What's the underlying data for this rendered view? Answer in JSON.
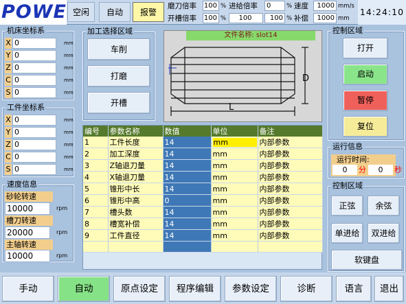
{
  "header": {
    "logo": "POWER",
    "modes": [
      {
        "label": "空闲",
        "active": false
      },
      {
        "label": "自动",
        "active": false
      },
      {
        "label": "报警",
        "active": true
      }
    ],
    "row1": {
      "feed_rate_label": "磨刀倍率",
      "feed_rate_value": "100",
      "feed_rate_unit": "%",
      "jog_rate_label": "进给倍率",
      "jog_rate_value": "0",
      "jog_rate_unit": "%",
      "speed_label": "速度",
      "speed_value": "1000",
      "speed_unit": "mm/s"
    },
    "row2": {
      "slot_rate_label": "开槽倍率",
      "slot_rate_value": "100",
      "slot_rate_unit": "%",
      "mid_value": "100",
      "mid_unit": "%",
      "comp_label": "补偿",
      "comp_value": "1000",
      "comp_unit": "mm"
    },
    "clock": "14:24:10"
  },
  "machine_coords": {
    "title": "机床坐标系",
    "rows": [
      {
        "axis": "X",
        "value": "0",
        "unit": "mm"
      },
      {
        "axis": "Y",
        "value": "0",
        "unit": "mm"
      },
      {
        "axis": "Z",
        "value": "0",
        "unit": "mm"
      },
      {
        "axis": "C",
        "value": "0",
        "unit": "mm"
      },
      {
        "axis": "S",
        "value": "0",
        "unit": "mm"
      }
    ]
  },
  "work_coords": {
    "title": "工件坐标系",
    "rows": [
      {
        "axis": "X",
        "value": "0",
        "unit": "mm"
      },
      {
        "axis": "Y",
        "value": "0",
        "unit": "mm"
      },
      {
        "axis": "Z",
        "value": "0",
        "unit": "mm"
      },
      {
        "axis": "C",
        "value": "0",
        "unit": "mm"
      },
      {
        "axis": "S",
        "value": "0",
        "unit": "mm"
      }
    ]
  },
  "speed_info": {
    "title": "速度信息",
    "items": [
      {
        "label": "砂轮转速",
        "value": "10000",
        "unit": "rpm"
      },
      {
        "label": "槽刀转速",
        "value": "20000",
        "unit": "rpm"
      },
      {
        "label": "主轴转速",
        "value": "10000",
        "unit": "rpm"
      }
    ]
  },
  "process_select": {
    "title": "加工选择区域",
    "buttons": [
      "车削",
      "打磨",
      "开槽"
    ]
  },
  "preview": {
    "file_label": "文件名称:",
    "file_name": "slot14",
    "dim_d": "D",
    "dim_l": "L"
  },
  "control": {
    "title": "控制区域",
    "buttons": [
      {
        "label": "打开",
        "color": "#e6eef8"
      },
      {
        "label": "启动",
        "color": "#8ae58a"
      },
      {
        "label": "暂停",
        "color": "#f0605a"
      },
      {
        "label": "复位",
        "color": "#f5eb98"
      }
    ]
  },
  "run_info": {
    "title": "运行信息",
    "time_label": "运行时间:",
    "minutes": "0",
    "min_unit": "分",
    "seconds": "0",
    "sec_unit": "秒"
  },
  "control2": {
    "title": "控制区域",
    "buttons": [
      "正弦",
      "余弦",
      "单进给",
      "双进给"
    ],
    "keyboard": "软键盘"
  },
  "table": {
    "headers": [
      "编号",
      "参数名称",
      "数值",
      "单位",
      "备注"
    ],
    "rows": [
      [
        "1",
        "工件长度",
        "14",
        "mm",
        "内部参数"
      ],
      [
        "2",
        "加工深度",
        "14",
        "mm",
        "内部参数"
      ],
      [
        "3",
        "Z轴退刀量",
        "14",
        "mm",
        "内部参数"
      ],
      [
        "4",
        "X轴退刀量",
        "14",
        "mm",
        "内部参数"
      ],
      [
        "5",
        "锥形中长",
        "14",
        "mm",
        "内部参数"
      ],
      [
        "6",
        "锥形中高",
        "0",
        "mm",
        "内部参数"
      ],
      [
        "7",
        "槽头数",
        "14",
        "mm",
        "内部参数"
      ],
      [
        "8",
        "槽宽补偿",
        "14",
        "mm",
        "内部参数"
      ],
      [
        "9",
        "工件直径",
        "14",
        "mm",
        "内部参数"
      ]
    ]
  },
  "bottom_tabs": [
    {
      "label": "手动",
      "active": false
    },
    {
      "label": "自动",
      "active": true
    },
    {
      "label": "原点设定",
      "active": false
    },
    {
      "label": "程序编辑",
      "active": false
    },
    {
      "label": "参数设定",
      "active": false
    },
    {
      "label": "诊断",
      "active": false
    },
    {
      "label": "语言",
      "active": false
    },
    {
      "label": "退出",
      "active": false
    }
  ]
}
